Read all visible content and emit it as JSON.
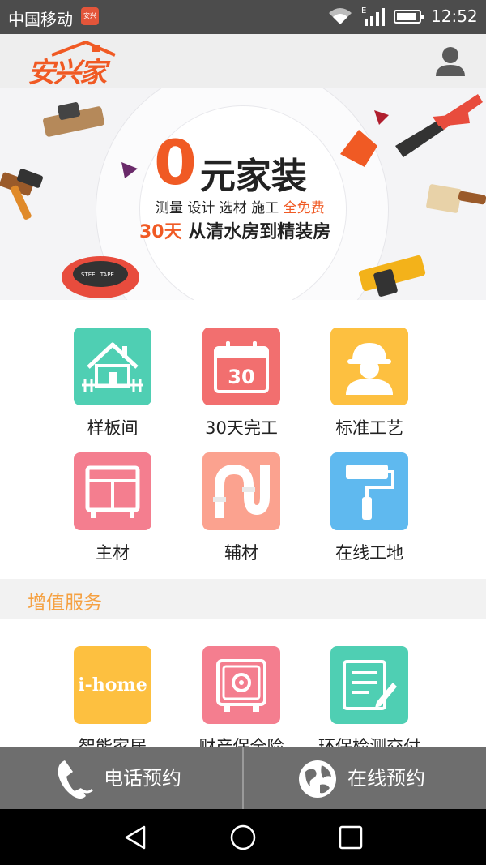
{
  "status_bar": {
    "carrier": "中国移动",
    "network_type": "E",
    "time": "12:52"
  },
  "header": {
    "logo_text": "安兴家"
  },
  "banner": {
    "headline_zero": "0",
    "headline_rest": "元家装",
    "services": "测量 设计 选材 施工 ",
    "services_free": "全免费",
    "promise_days": "30天",
    "promise_text": " 从清水房到精装房",
    "tape_label": "STEEL TAPE"
  },
  "main_grid": [
    {
      "label": "样板间",
      "icon": "house-icon",
      "color": "#4fcfb3"
    },
    {
      "label": "30天完工",
      "icon": "calendar-30-icon",
      "color": "#f26f6f",
      "icon_text": "30"
    },
    {
      "label": "标准工艺",
      "icon": "worker-helmet-icon",
      "color": "#fdc040"
    },
    {
      "label": "主材",
      "icon": "cabinet-icon",
      "color": "#f47e8f"
    },
    {
      "label": "辅材",
      "icon": "pipe-icon",
      "color": "#fba28f"
    },
    {
      "label": "在线工地",
      "icon": "paint-roller-icon",
      "color": "#5fb9ef"
    }
  ],
  "value_added": {
    "title": "增值服务",
    "items": [
      {
        "label": "智能家居",
        "icon": "ihome-logo-icon",
        "color": "#fdc040",
        "icon_text": "i-home"
      },
      {
        "label": "财产保全险",
        "icon": "safe-icon",
        "color": "#f47e8f"
      },
      {
        "label": "环保检测交付",
        "icon": "document-pen-icon",
        "color": "#4fcfb3"
      }
    ]
  },
  "action_bar": {
    "phone_label": "电话预约",
    "online_label": "在线预约"
  }
}
